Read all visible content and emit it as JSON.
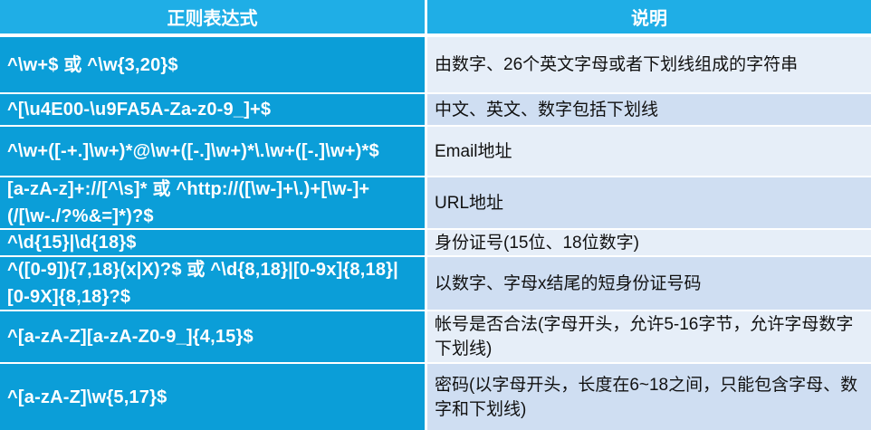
{
  "header": {
    "col1": "正则表达式",
    "col2": "说明"
  },
  "rows": [
    {
      "regex": "^\\w+$ 或 ^\\w{3,20}$",
      "desc": "由数字、26个英文字母或者下划线组成的字符串"
    },
    {
      "regex": "^[\\u4E00-\\u9FA5A-Za-z0-9_]+$",
      "desc": "中文、英文、数字包括下划线"
    },
    {
      "regex": "^\\w+([-+.]\\w+)*@\\w+([-.]\\w+)*\\.\\w+([-.]\\w+)*$",
      "desc": "Email地址"
    },
    {
      "regex": "[a-zA-z]+://[^\\s]* 或 ^http://([\\w-]+\\.)+[\\w-]+(/[\\w-./?%&=]*)?$",
      "desc": "URL地址"
    },
    {
      "regex": "^\\d{15}|\\d{18}$",
      "desc": "身份证号(15位、18位数字)"
    },
    {
      "regex": "^([0-9]){7,18}(x|X)?$ 或 ^\\d{8,18}|[0-9x]{8,18}|[0-9X]{8,18}?$",
      "desc": "以数字、字母x结尾的短身份证号码"
    },
    {
      "regex": "^[a-zA-Z][a-zA-Z0-9_]{4,15}$",
      "desc": "帐号是否合法(字母开头，允许5-16字节，允许字母数字下划线)"
    },
    {
      "regex": "^[a-zA-Z]\\w{5,17}$",
      "desc": "密码(以字母开头，长度在6~18之间，只能包含字母、数字和下划线)"
    }
  ]
}
